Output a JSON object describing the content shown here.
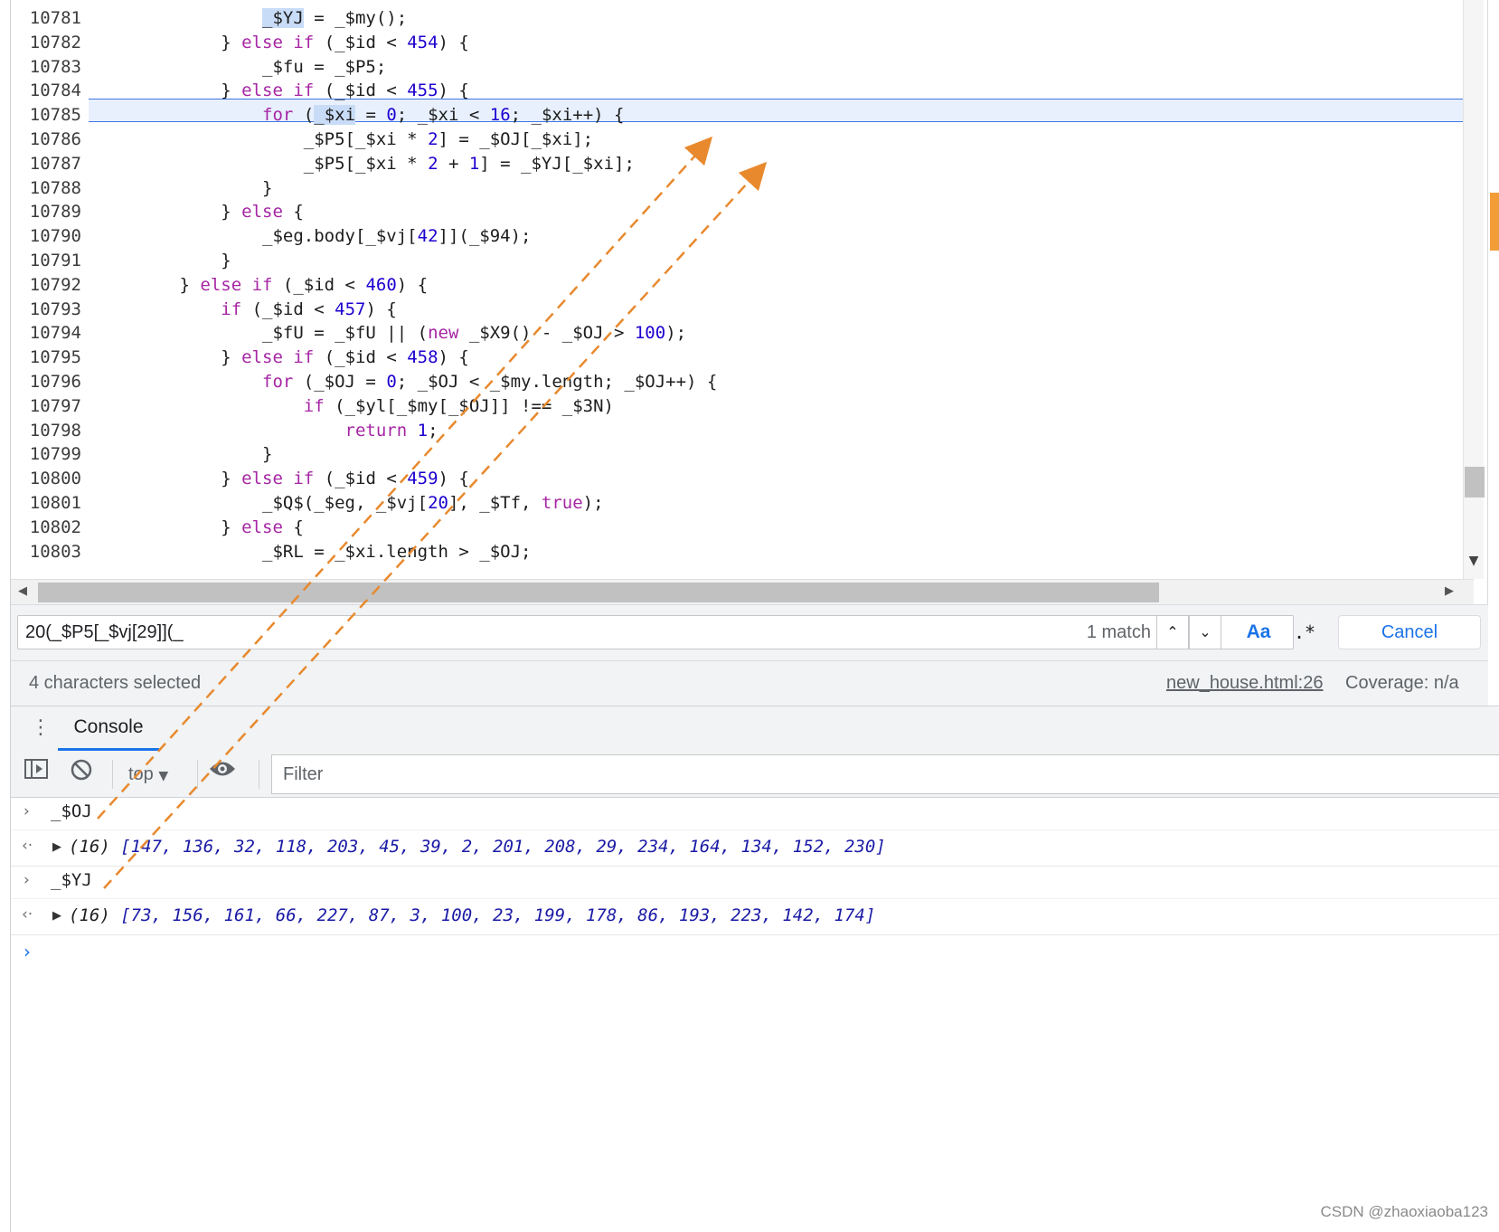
{
  "editor": {
    "lines": [
      {
        "n": "10781",
        "parts": [
          [
            "sp",
            "                "
          ],
          [
            "hl",
            "_$YJ"
          ],
          [
            "t",
            " = _$my();"
          ]
        ]
      },
      {
        "n": "10782",
        "parts": [
          [
            "sp",
            "            "
          ],
          [
            "t",
            "} "
          ],
          [
            "kw",
            "else if"
          ],
          [
            "t",
            " (_$id < "
          ],
          [
            "num",
            "454"
          ],
          [
            "t",
            ") {"
          ]
        ]
      },
      {
        "n": "10783",
        "parts": [
          [
            "sp",
            "                "
          ],
          [
            "t",
            "_$fu = _$P5;"
          ]
        ]
      },
      {
        "n": "10784",
        "parts": [
          [
            "sp",
            "            "
          ],
          [
            "t",
            "} "
          ],
          [
            "kw",
            "else if"
          ],
          [
            "t",
            " (_$id < "
          ],
          [
            "num",
            "455"
          ],
          [
            "t",
            ") {"
          ]
        ]
      },
      {
        "n": "10785",
        "parts": [
          [
            "sp",
            "                "
          ],
          [
            "kw",
            "for"
          ],
          [
            "t",
            " ("
          ],
          [
            "hl",
            "_$xi"
          ],
          [
            "t",
            " = "
          ],
          [
            "num",
            "0"
          ],
          [
            "t",
            "; _$xi < "
          ],
          [
            "num",
            "16"
          ],
          [
            "t",
            "; _$xi++) {"
          ]
        ]
      },
      {
        "n": "10786",
        "parts": [
          [
            "sp",
            "                    "
          ],
          [
            "t",
            "_$P5[_$xi * "
          ],
          [
            "num",
            "2"
          ],
          [
            "t",
            "] = _$OJ[_$xi];"
          ]
        ]
      },
      {
        "n": "10787",
        "parts": [
          [
            "sp",
            "                    "
          ],
          [
            "t",
            "_$P5[_$xi * "
          ],
          [
            "num",
            "2"
          ],
          [
            "t",
            " + "
          ],
          [
            "num",
            "1"
          ],
          [
            "t",
            "] = _$YJ[_$xi];"
          ]
        ]
      },
      {
        "n": "10788",
        "parts": [
          [
            "sp",
            "                "
          ],
          [
            "t",
            "}"
          ]
        ]
      },
      {
        "n": "10789",
        "parts": [
          [
            "sp",
            "            "
          ],
          [
            "t",
            "} "
          ],
          [
            "kw",
            "else"
          ],
          [
            "t",
            " {"
          ]
        ]
      },
      {
        "n": "10790",
        "parts": [
          [
            "sp",
            "                "
          ],
          [
            "t",
            "_$eg.body[_$vj["
          ],
          [
            "num",
            "42"
          ],
          [
            "t",
            "]](_$94);"
          ]
        ]
      },
      {
        "n": "10791",
        "parts": [
          [
            "sp",
            "            "
          ],
          [
            "t",
            "}"
          ]
        ]
      },
      {
        "n": "10792",
        "parts": [
          [
            "sp",
            "        "
          ],
          [
            "t",
            "} "
          ],
          [
            "kw",
            "else if"
          ],
          [
            "t",
            " (_$id < "
          ],
          [
            "num",
            "460"
          ],
          [
            "t",
            ") {"
          ]
        ]
      },
      {
        "n": "10793",
        "parts": [
          [
            "sp",
            "            "
          ],
          [
            "kw",
            "if"
          ],
          [
            "t",
            " (_$id < "
          ],
          [
            "num",
            "457"
          ],
          [
            "t",
            ") {"
          ]
        ]
      },
      {
        "n": "10794",
        "parts": [
          [
            "sp",
            "                "
          ],
          [
            "t",
            "_$fU = _$fU || ("
          ],
          [
            "kw",
            "new"
          ],
          [
            "t",
            " _$X9() - _$OJ > "
          ],
          [
            "num",
            "100"
          ],
          [
            "t",
            ");"
          ]
        ]
      },
      {
        "n": "10795",
        "parts": [
          [
            "sp",
            "            "
          ],
          [
            "t",
            "} "
          ],
          [
            "kw",
            "else if"
          ],
          [
            "t",
            " (_$id < "
          ],
          [
            "num",
            "458"
          ],
          [
            "t",
            ") {"
          ]
        ]
      },
      {
        "n": "10796",
        "parts": [
          [
            "sp",
            "                "
          ],
          [
            "kw",
            "for"
          ],
          [
            "t",
            " (_$OJ = "
          ],
          [
            "num",
            "0"
          ],
          [
            "t",
            "; _$OJ < _$my.length; _$OJ++) {"
          ]
        ]
      },
      {
        "n": "10797",
        "parts": [
          [
            "sp",
            "                    "
          ],
          [
            "kw",
            "if"
          ],
          [
            "t",
            " (_$yl[_$my[_$OJ]] !== _$3N)"
          ]
        ]
      },
      {
        "n": "10798",
        "parts": [
          [
            "sp",
            "                        "
          ],
          [
            "kw",
            "return"
          ],
          [
            "t",
            " "
          ],
          [
            "num",
            "1"
          ],
          [
            "t",
            ";"
          ]
        ]
      },
      {
        "n": "10799",
        "parts": [
          [
            "sp",
            "                "
          ],
          [
            "t",
            "}"
          ]
        ]
      },
      {
        "n": "10800",
        "parts": [
          [
            "sp",
            "            "
          ],
          [
            "t",
            "} "
          ],
          [
            "kw",
            "else if"
          ],
          [
            "t",
            " (_$id < "
          ],
          [
            "num",
            "459"
          ],
          [
            "t",
            ") {"
          ]
        ]
      },
      {
        "n": "10801",
        "parts": [
          [
            "sp",
            "                "
          ],
          [
            "t",
            "_$Q$(_$eg, _$vj["
          ],
          [
            "num",
            "20"
          ],
          [
            "t",
            "], _$Tf, "
          ],
          [
            "kw",
            "true"
          ],
          [
            "t",
            ");"
          ]
        ]
      },
      {
        "n": "10802",
        "parts": [
          [
            "sp",
            "            "
          ],
          [
            "t",
            "} "
          ],
          [
            "kw",
            "else"
          ],
          [
            "t",
            " {"
          ]
        ]
      },
      {
        "n": "10803",
        "parts": [
          [
            "sp",
            "                "
          ],
          [
            "t",
            "_$RL = _$xi.length > _$OJ;"
          ]
        ]
      }
    ],
    "execution_line": "10785"
  },
  "search": {
    "query": "20(_$P5[_$vj[29]](_",
    "match_count": "1 match",
    "prev_label": "⌃",
    "next_label": "⌄",
    "case_label": "Aa",
    "regex_label": ".*",
    "cancel_label": "Cancel"
  },
  "status": {
    "selection": "4 characters selected",
    "source": "new_house.html:26",
    "coverage": "Coverage: n/a"
  },
  "drawer": {
    "tab_label": "Console",
    "context": "top",
    "filter_placeholder": "Filter"
  },
  "console": {
    "entries": [
      {
        "command": "_$OJ",
        "len": "(16)",
        "values": "[147, 136, 32, 118, 203, 45, 39, 2, 201, 208, 29, 234, 164, 134, 152, 230]"
      },
      {
        "command": "_$YJ",
        "len": "(16)",
        "values": "[73, 156, 161, 66, 227, 87, 3, 100, 23, 199, 178, 86, 193, 223, 142, 174]"
      }
    ],
    "prompt": "›"
  },
  "watermark": "CSDN @zhaoxiaoba123",
  "colors": {
    "accent": "#1a73e8",
    "annotation_arrow": "#e8892e",
    "keyword": "#a626a4",
    "number": "#1c00cf"
  }
}
